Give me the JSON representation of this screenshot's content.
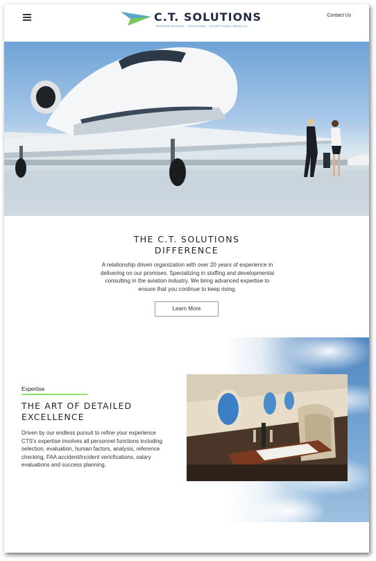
{
  "header": {
    "menu_icon": "hamburger-menu-icon",
    "logo_name": "C.T. SOLUTIONS",
    "logo_tagline": "TRUSTED SOURCE · SOLUTIONS · EXCEPTIONAL RESULTS",
    "contact_label": "Contact Us"
  },
  "difference": {
    "title_line1": "THE C.T. SOLUTIONS",
    "title_line2": "DIFFERENCE",
    "body": "A relationship driven organization with over 20 years of experience in delivering on our promises. Specializing in staffing and developmental consulting in the aviation industry. We bring advanced expertise to ensure that you continue to keep rising.",
    "button_label": "Learn More"
  },
  "expertise": {
    "label": "Expertise",
    "title_line1": "THE ART OF DETAILED",
    "title_line2": "EXCELLENCE",
    "body": "Driven by our endless pursuit to refine your experience CTS's expertise involves all personnel functions including selection, evaluation, human factors, analysis, reference checking, FAA accident/incident vericfications, salary evaluations and success planning."
  },
  "colors": {
    "accent_green": "#8be06a",
    "brand_navy": "#1f2a44",
    "logo_teal": "#5aa7c8"
  }
}
